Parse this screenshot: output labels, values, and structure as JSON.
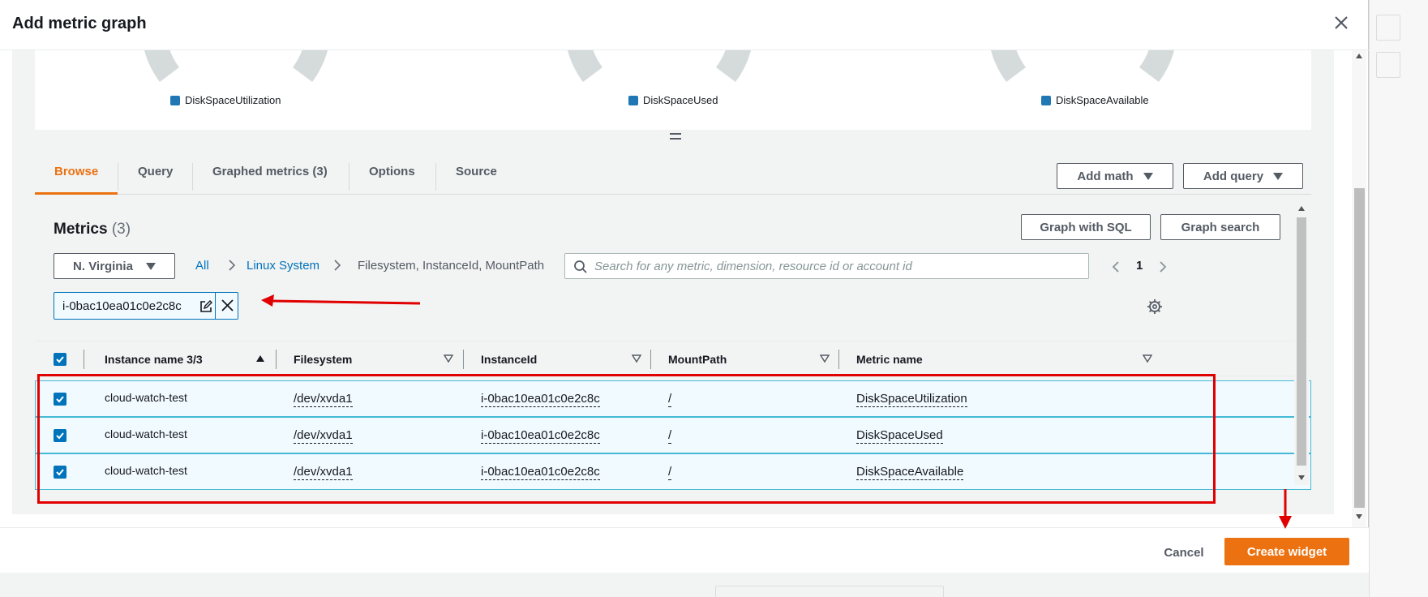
{
  "modal": {
    "title": "Add metric graph"
  },
  "gauges": [
    {
      "legend": "DiskSpaceUtilization"
    },
    {
      "legend": "DiskSpaceUsed"
    },
    {
      "legend": "DiskSpaceAvailable"
    }
  ],
  "tabs": [
    {
      "label": "Browse",
      "active": true
    },
    {
      "label": "Query"
    },
    {
      "label": "Graphed metrics (3)"
    },
    {
      "label": "Options"
    },
    {
      "label": "Source"
    }
  ],
  "toolbar": {
    "add_math": "Add math",
    "add_query": "Add query"
  },
  "metrics": {
    "title": "Metrics",
    "count": "(3)",
    "graph_with_sql": "Graph with SQL",
    "graph_search": "Graph search",
    "region": "N. Virginia",
    "breadcrumb": {
      "all": "All",
      "namespace": "Linux System",
      "dimensions": "Filesystem, InstanceId, MountPath"
    },
    "search_placeholder": "Search for any metric, dimension, resource id or account id",
    "page": "1",
    "filter_token": "i-0bac10ea01c0e2c8c"
  },
  "table": {
    "columns": [
      "Instance name 3/3",
      "Filesystem",
      "InstanceId",
      "MountPath",
      "Metric name"
    ],
    "rows": [
      {
        "instance_name": "cloud-watch-test",
        "filesystem": "/dev/xvda1",
        "instance_id": "i-0bac10ea01c0e2c8c",
        "mount_path": "/",
        "metric_name": "DiskSpaceUtilization"
      },
      {
        "instance_name": "cloud-watch-test",
        "filesystem": "/dev/xvda1",
        "instance_id": "i-0bac10ea01c0e2c8c",
        "mount_path": "/",
        "metric_name": "DiskSpaceUsed"
      },
      {
        "instance_name": "cloud-watch-test",
        "filesystem": "/dev/xvda1",
        "instance_id": "i-0bac10ea01c0e2c8c",
        "mount_path": "/",
        "metric_name": "DiskSpaceAvailable"
      }
    ]
  },
  "footer": {
    "cancel": "Cancel",
    "create": "Create widget"
  },
  "colors": {
    "accent": "#ec7211",
    "link": "#0073bb",
    "annotation": "#e00000",
    "legend": "#1f77b4"
  },
  "icons": [
    "close-icon",
    "search-icon",
    "edit-icon",
    "remove-icon",
    "gear-icon",
    "chevron-left-icon",
    "chevron-right-icon",
    "caret-down-icon",
    "sort-ascending-icon",
    "sort-descending-icon",
    "checkbox-checked-icon"
  ]
}
